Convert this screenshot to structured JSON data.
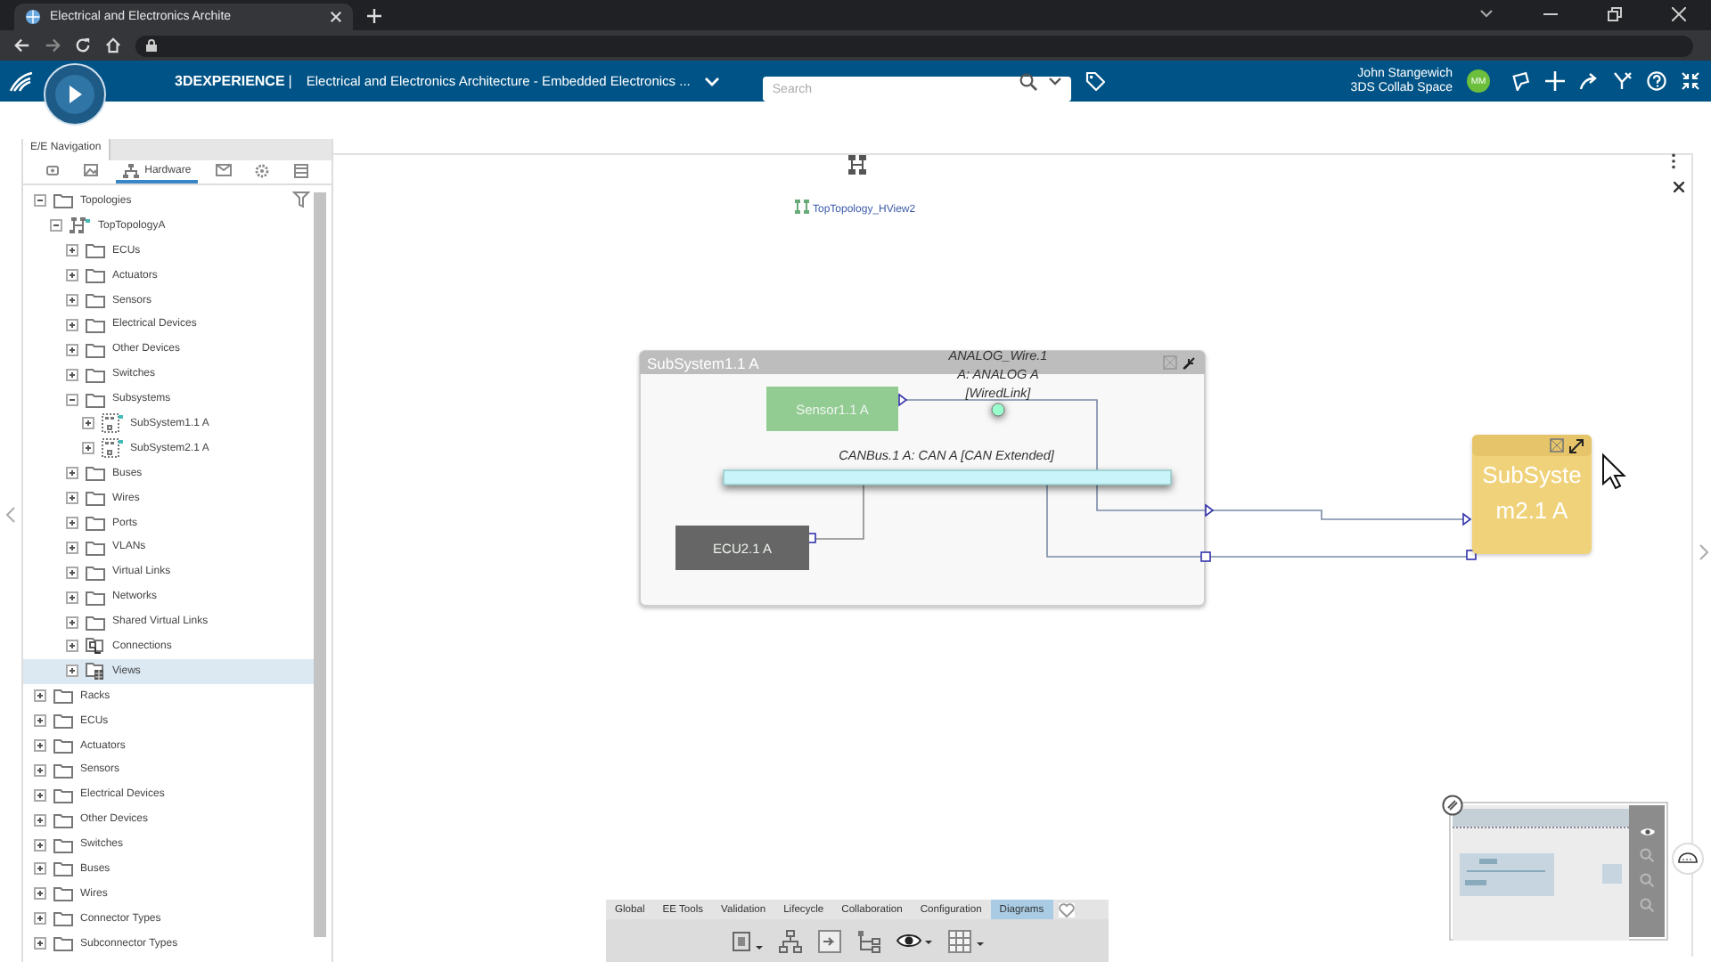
{
  "browser": {
    "tab_title": "Electrical and Electronics Archite"
  },
  "header": {
    "brand": "3DEXPERIENCE",
    "separator": "|",
    "app_title": "Electrical and Electronics Architecture - Embedded Electronics ...",
    "search": {
      "placeholder": "Search"
    },
    "user": {
      "name": "John Stangewich",
      "space": "3DS Collab Space",
      "initials": "MM"
    }
  },
  "panel": {
    "title": "E/E Navigation",
    "tabs": [
      {
        "kind": "camera",
        "selected": false
      },
      {
        "kind": "image",
        "selected": false
      },
      {
        "kind": "hardware",
        "label": "Hardware",
        "selected": true
      },
      {
        "kind": "envelope",
        "selected": false
      },
      {
        "kind": "gear",
        "selected": false
      },
      {
        "kind": "table",
        "selected": false
      }
    ],
    "tree": [
      {
        "label": "Topologies",
        "kind": "folder",
        "expanded": true,
        "selected": false,
        "children": [
          {
            "label": "TopTopologyA",
            "kind": "topology",
            "expanded": true,
            "selected": false,
            "children": [
              {
                "label": "ECUs",
                "kind": "folder",
                "expanded": false,
                "selected": false
              },
              {
                "label": "Actuators",
                "kind": "folder",
                "expanded": false,
                "selected": false
              },
              {
                "label": "Sensors",
                "kind": "folder",
                "expanded": false,
                "selected": false
              },
              {
                "label": "Electrical Devices",
                "kind": "folder",
                "expanded": false,
                "selected": false
              },
              {
                "label": "Other Devices",
                "kind": "folder",
                "expanded": false,
                "selected": false
              },
              {
                "label": "Switches",
                "kind": "folder",
                "expanded": false,
                "selected": false
              },
              {
                "label": "Subsystems",
                "kind": "folder",
                "expanded": true,
                "selected": false,
                "children": [
                  {
                    "label": "SubSystem1.1 A",
                    "kind": "subsystem",
                    "expanded": false,
                    "selected": false
                  },
                  {
                    "label": "SubSystem2.1 A",
                    "kind": "subsystem",
                    "expanded": false,
                    "selected": false
                  }
                ]
              },
              {
                "label": "Buses",
                "kind": "folder",
                "expanded": false,
                "selected": false
              },
              {
                "label": "Wires",
                "kind": "folder",
                "expanded": false,
                "selected": false
              },
              {
                "label": "Ports",
                "kind": "folder",
                "expanded": false,
                "selected": false
              },
              {
                "label": "VLANs",
                "kind": "folder",
                "expanded": false,
                "selected": false
              },
              {
                "label": "Virtual Links",
                "kind": "folder",
                "expanded": false,
                "selected": false
              },
              {
                "label": "Networks",
                "kind": "folder",
                "expanded": false,
                "selected": false
              },
              {
                "label": "Shared Virtual Links",
                "kind": "folder",
                "expanded": false,
                "selected": false
              },
              {
                "label": "Connections",
                "kind": "connections",
                "expanded": false,
                "selected": false
              },
              {
                "label": "Views",
                "kind": "views",
                "expanded": false,
                "selected": true
              }
            ]
          }
        ]
      },
      {
        "label": "Racks",
        "kind": "folder",
        "expanded": false,
        "selected": false
      },
      {
        "label": "ECUs",
        "kind": "folder",
        "expanded": false,
        "selected": false
      },
      {
        "label": "Actuators",
        "kind": "folder",
        "expanded": false,
        "selected": false
      },
      {
        "label": "Sensors",
        "kind": "folder",
        "expanded": false,
        "selected": false
      },
      {
        "label": "Electrical Devices",
        "kind": "folder",
        "expanded": false,
        "selected": false
      },
      {
        "label": "Other Devices",
        "kind": "folder",
        "expanded": false,
        "selected": false
      },
      {
        "label": "Switches",
        "kind": "folder",
        "expanded": false,
        "selected": false
      },
      {
        "label": "Buses",
        "kind": "folder",
        "expanded": false,
        "selected": false
      },
      {
        "label": "Wires",
        "kind": "folder",
        "expanded": false,
        "selected": false
      },
      {
        "label": "Connector Types",
        "kind": "folder",
        "expanded": false,
        "selected": false
      },
      {
        "label": "Subconnector Types",
        "kind": "folder",
        "expanded": false,
        "selected": false
      }
    ]
  },
  "diagram": {
    "view_label": "TopTopology_HView2",
    "container": {
      "title": "SubSystem1.1 A"
    },
    "wire": {
      "lines": [
        "ANALOG_Wire.1",
        "A: ANALOG A",
        "[WiredLink]"
      ]
    },
    "sensor": {
      "label": "Sensor1.1 A"
    },
    "bus": {
      "label": "CANBus.1 A: CAN A [CAN Extended]"
    },
    "ecu": {
      "label": "ECU2.1 A"
    },
    "subsystem": {
      "lines": [
        "SubSyste",
        "m2.1 A"
      ]
    }
  },
  "toolbar": {
    "tabs": [
      {
        "label": "Global",
        "selected": false
      },
      {
        "label": "EE Tools",
        "selected": false
      },
      {
        "label": "Validation",
        "selected": false
      },
      {
        "label": "Lifecycle",
        "selected": false
      },
      {
        "label": "Collaboration",
        "selected": false
      },
      {
        "label": "Configuration",
        "selected": false
      },
      {
        "label": "Diagrams",
        "selected": true
      }
    ]
  }
}
